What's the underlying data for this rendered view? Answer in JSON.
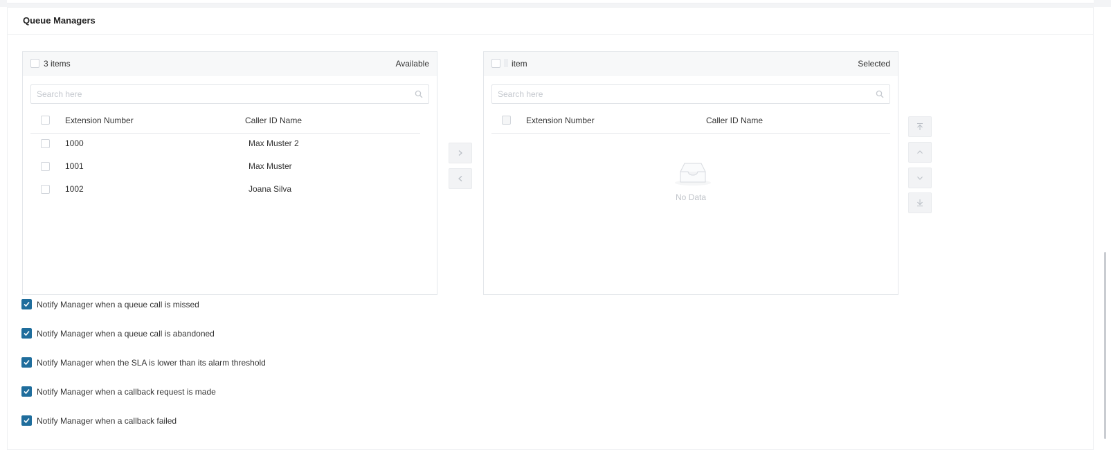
{
  "section": {
    "title": "Queue Managers"
  },
  "available": {
    "count_label": "3 items",
    "header_label": "Available",
    "search_placeholder": "Search here",
    "columns": [
      "Extension Number",
      "Caller ID Name"
    ],
    "rows": [
      {
        "extension": "1000",
        "name": "Max Muster 2"
      },
      {
        "extension": "1001",
        "name": "Max Muster"
      },
      {
        "extension": "1002",
        "name": "Joana Silva"
      }
    ]
  },
  "selected": {
    "count_label": "item",
    "header_label": "Selected",
    "search_placeholder": "Search here",
    "columns": [
      "Extension Number",
      "Caller ID Name"
    ],
    "empty_text": "No Data"
  },
  "transfer": {
    "right_icon": "chevron-right-icon",
    "left_icon": "chevron-left-icon"
  },
  "order": {
    "icons": [
      "move-top-icon",
      "move-up-icon",
      "move-down-icon",
      "move-bottom-icon"
    ]
  },
  "notifications": [
    {
      "label": "Notify Manager when a queue call is missed",
      "checked": true
    },
    {
      "label": "Notify Manager when a queue call is abandoned",
      "checked": true
    },
    {
      "label": "Notify Manager when the SLA is lower than its alarm threshold",
      "checked": true
    },
    {
      "label": "Notify Manager when a callback request is made",
      "checked": true
    },
    {
      "label": "Notify Manager when a callback failed",
      "checked": true
    }
  ],
  "colors": {
    "accent": "#1f6d9c",
    "muted": "#bfc3c9",
    "border": "#e4e7eb"
  }
}
